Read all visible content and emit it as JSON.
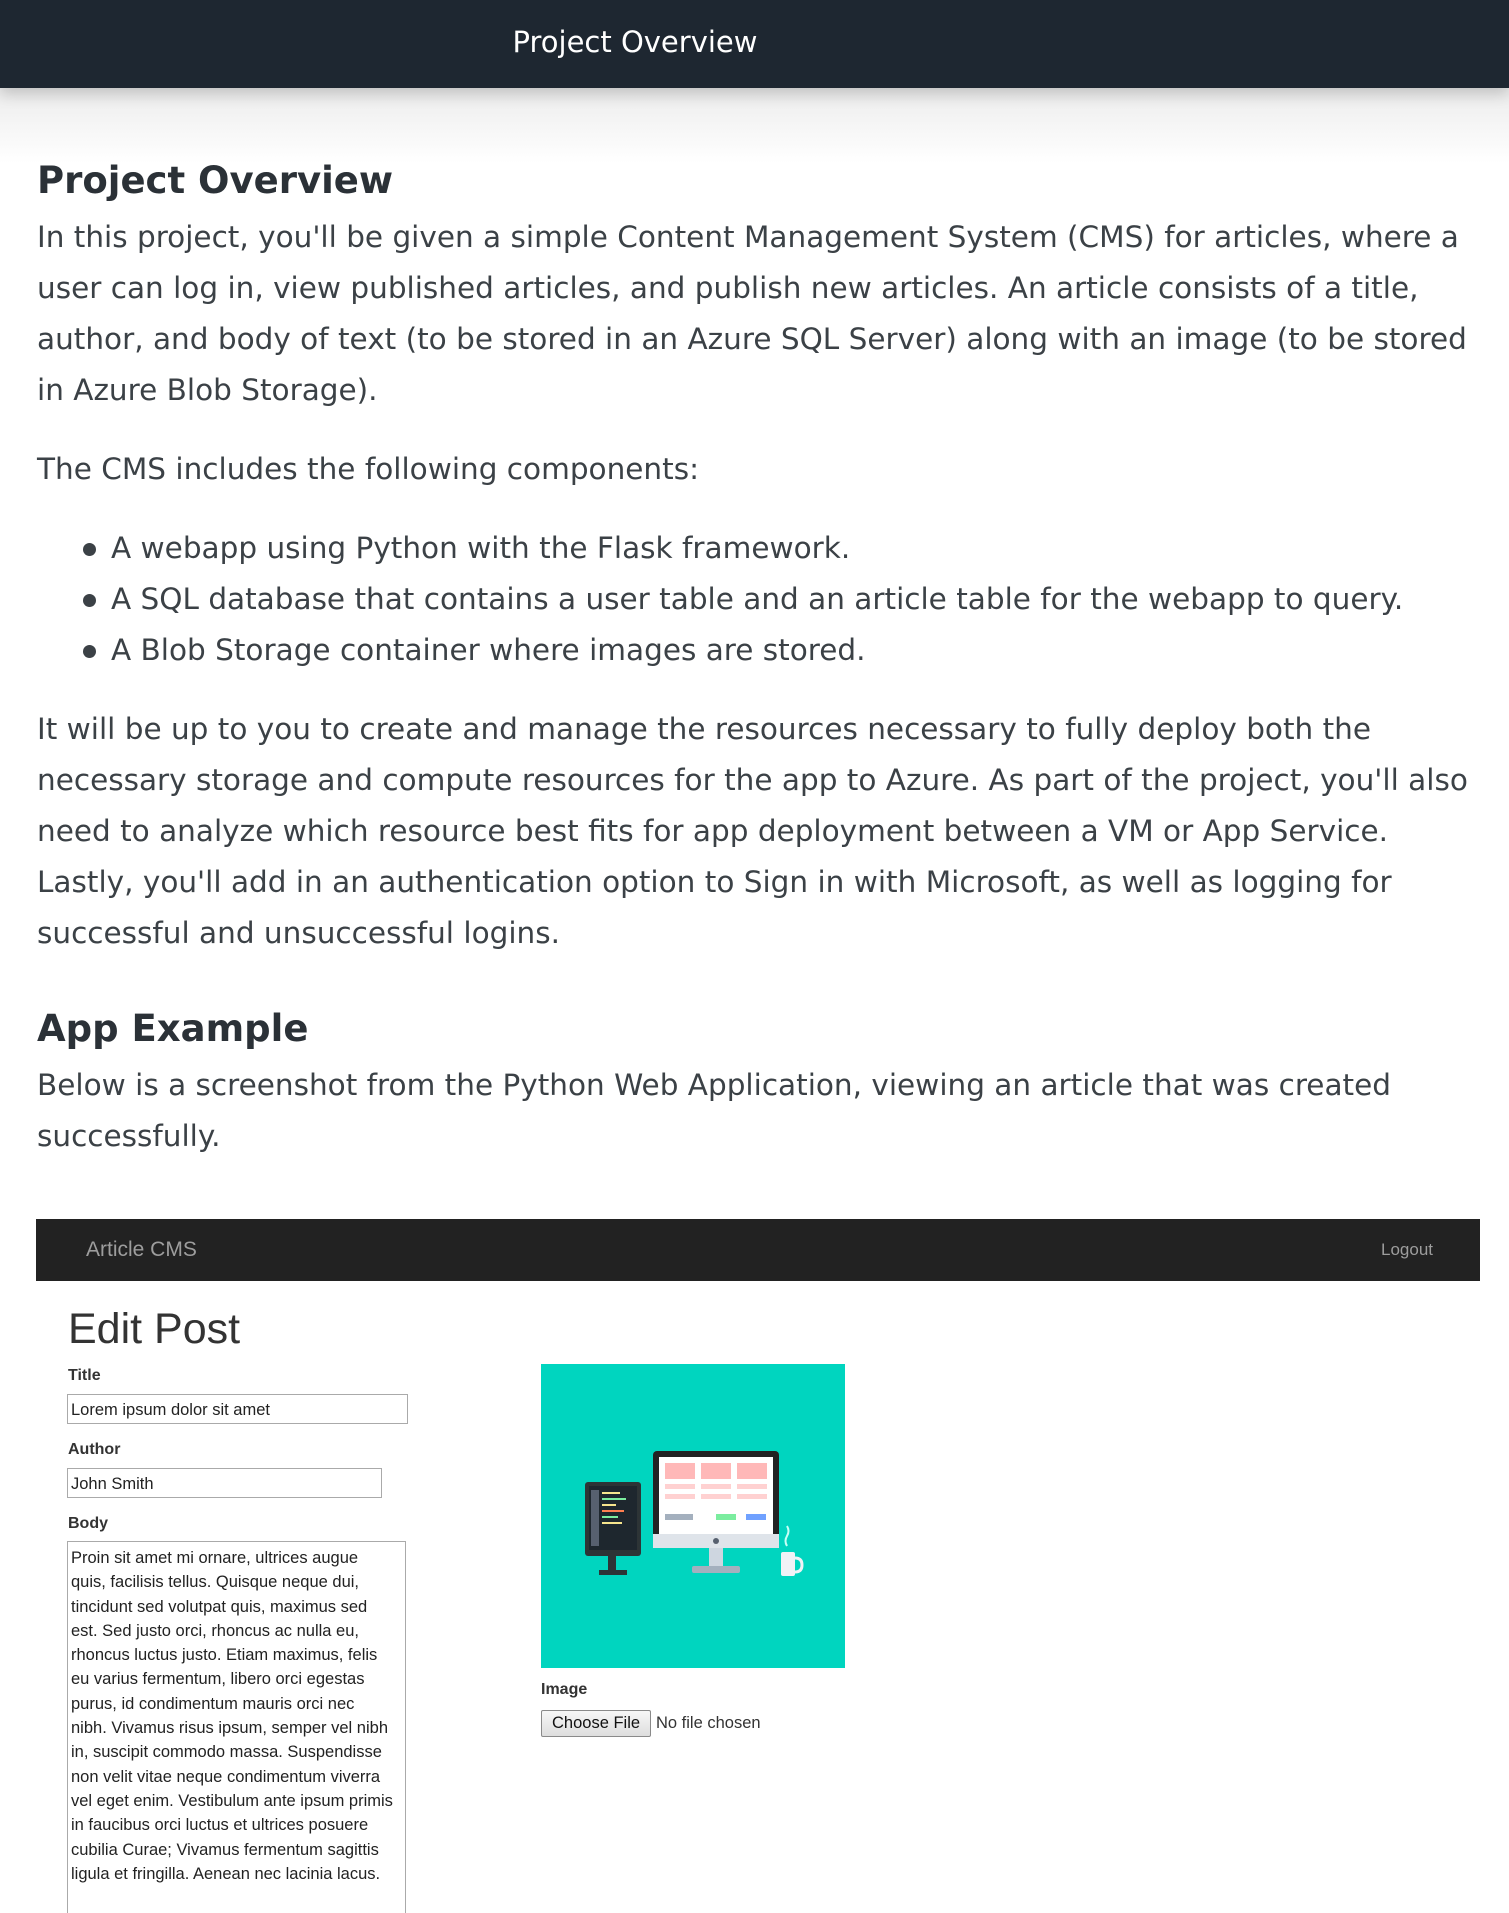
{
  "header": {
    "title": "Project Overview"
  },
  "overview": {
    "heading": "Project Overview",
    "intro": "In this project, you'll be given a simple Content Management System (CMS) for articles, where a user can log in, view published articles, and publish new articles. An article consists of a title, author, and body of text (to be stored in an Azure SQL Server) along with an image (to be stored in Azure Blob Storage).",
    "components_intro": "The CMS includes the following components:",
    "components": [
      "A webapp using Python with the Flask framework.",
      "A SQL database that contains a user table and an article table for the webapp to query.",
      "A Blob Storage container where images are stored."
    ],
    "closing": "It will be up to you to create and manage the resources necessary to fully deploy both the necessary storage and compute resources for the app to Azure. As part of the project, you'll also need to analyze which resource best fits for app deployment between a VM or App Service. Lastly, you'll add in an authentication option to Sign in with Microsoft, as well as logging for successful and unsuccessful logins."
  },
  "app_example": {
    "heading": "App Example",
    "description": "Below is a screenshot from the Python Web Application, viewing an article that was created successfully."
  },
  "screenshot": {
    "brand": "Article CMS",
    "logout": "Logout",
    "page_title": "Edit Post",
    "title_label": "Title",
    "title_value": "Lorem ipsum dolor sit amet",
    "author_label": "Author",
    "author_value": "John Smith",
    "body_label": "Body",
    "body_value": "Proin sit amet mi ornare, ultrices augue\nquis, facilisis tellus. Quisque neque dui,\ntincidunt sed volutpat quis, maximus sed\nest. Sed justo orci, rhoncus ac nulla eu,\nrhoncus luctus justo. Etiam maximus, felis\neu varius fermentum, libero orci egestas\npurus, id condimentum mauris orci nec\nnibh. Vivamus risus ipsum, semper vel nibh\nin, suscipit commodo massa. Suspendisse\nnon velit vitae neque condimentum viverra\nvel eget enim. Vestibulum ante ipsum primis\nin faucibus orci luctus et ultrices posuere\ncubilia Curae; Vivamus fermentum sagittis\nligula et fringilla. Aenean nec lacinia lacus.",
    "image_label": "Image",
    "choose_file": "Choose File",
    "file_status": "No file chosen",
    "image_bg_color": "#00d5bf"
  }
}
